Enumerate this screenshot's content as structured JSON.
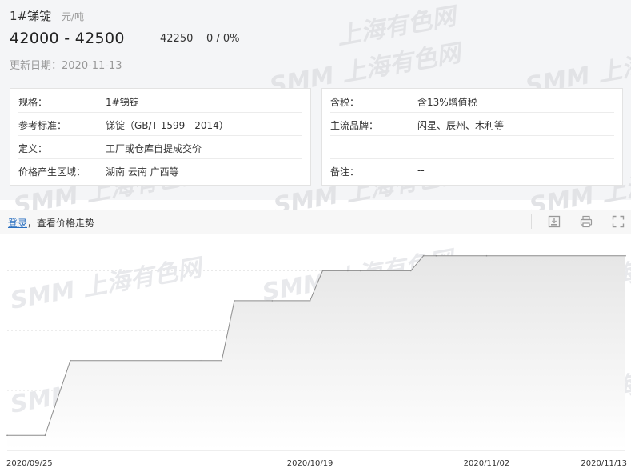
{
  "product": {
    "name": "1#锑锭",
    "unit": "元/吨",
    "price_range": "42000 - 42500",
    "average": "42250",
    "change": "0 / 0%",
    "update_label": "更新日期：",
    "update_date": "2020-11-13"
  },
  "details_left": [
    {
      "key": "规格：",
      "value": "1#锑锭"
    },
    {
      "key": "参考标准：",
      "value": "锑锭（GB/T 1599—2014）"
    },
    {
      "key": "定义：",
      "value": "工厂或仓库自提成交价"
    },
    {
      "key": "价格产生区域：",
      "value": "湖南 云南 广西等"
    }
  ],
  "details_right": [
    {
      "key": "含税：",
      "value": "含13%增值税"
    },
    {
      "key": "主流品牌：",
      "value": "闪星、辰州、木利等"
    },
    {
      "key": "",
      "value": ""
    },
    {
      "key": "备注：",
      "value": "--"
    }
  ],
  "watermark": {
    "logo": "SMM",
    "text": "上海有色网"
  },
  "toolbar": {
    "login_label": "登录",
    "login_tail": "，查看价格走势",
    "icons": [
      "download-icon",
      "print-icon",
      "fullscreen-icon"
    ]
  },
  "colors": {
    "link": "#2a6fc0",
    "line": "#8c8c8c",
    "area_top": "#e6e6e6",
    "panel_bg": "#f4f5f7"
  },
  "chart_data": {
    "type": "area",
    "xlabel": "",
    "ylabel": "",
    "x_tick_labels": [
      "2020/09/25",
      "2020/10/19",
      "2020/11/02",
      "2020/11/13"
    ],
    "y_tick_labels": [],
    "grid": "horizontal dashed",
    "series": [
      {
        "name": "",
        "x": [
          "2020/09/25",
          "2020/09/28",
          "2020/09/30",
          "2020/10/12",
          "2020/10/13",
          "2020/10/16",
          "2020/10/19",
          "2020/10/20",
          "2020/10/22",
          "2020/10/23",
          "2020/10/27",
          "2020/10/28",
          "2020/10/29",
          "2020/11/02",
          "2020/11/13"
        ],
        "values": [
          39250,
          39250,
          40500,
          40500,
          41500,
          41500,
          41500,
          42000,
          42000,
          42000,
          42000,
          42250,
          42250,
          42250,
          42250
        ]
      }
    ],
    "ylim": [
      39000,
      42500
    ]
  }
}
